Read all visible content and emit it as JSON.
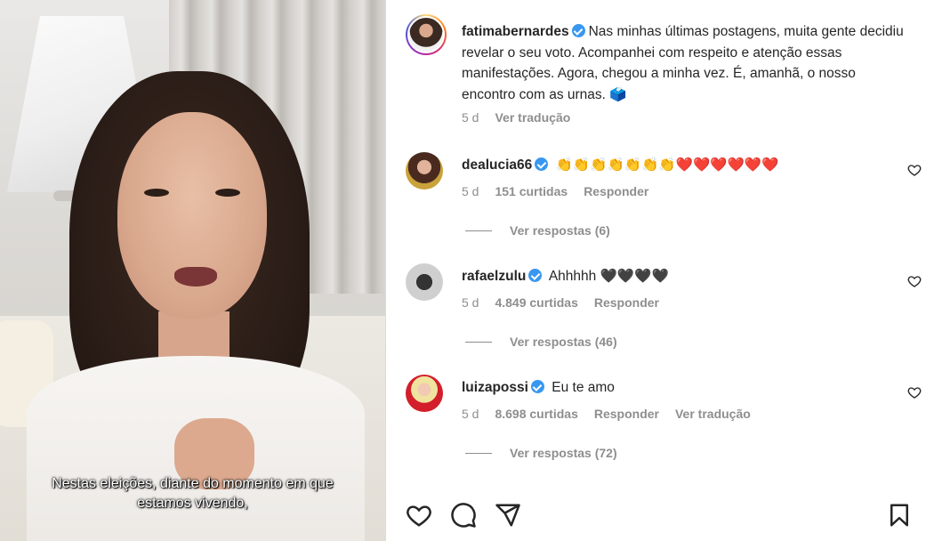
{
  "video": {
    "caption_line1": "Nestas eleições, diante do momento em que",
    "caption_line2": "estamos vivendo,"
  },
  "post": {
    "username": "fatimabernardes",
    "caption": "Nas minhas últimas postagens, muita gente decidiu revelar o seu voto. Acompanhei com respeito e atenção essas manifestações. Agora, chegou a minha vez. É, amanhã, o nosso encontro com as urnas. 🗳️",
    "time": "5 d",
    "translate": "Ver tradução"
  },
  "comments": [
    {
      "username": "dealucia66",
      "text": "👏👏👏👏👏👏👏❤️❤️❤️❤️❤️❤️",
      "time": "5 d",
      "likes": "151 curtidas",
      "reply": "Responder",
      "replies": "Ver respostas (6)"
    },
    {
      "username": "rafaelzulu",
      "text": "Ahhhhh 🖤🖤🖤🖤",
      "time": "5 d",
      "likes": "4.849 curtidas",
      "reply": "Responder",
      "replies": "Ver respostas (46)"
    },
    {
      "username": "luizapossi",
      "text": "Eu te amo",
      "time": "5 d",
      "likes": "8.698 curtidas",
      "reply": "Responder",
      "translate": "Ver tradução",
      "replies": "Ver respostas (72)"
    }
  ],
  "icons": {
    "like": "heart-icon",
    "comment": "comment-icon",
    "share": "share-icon",
    "save": "bookmark-icon",
    "verified": "verified-badge-icon"
  },
  "colors": {
    "verified": "#3897f0",
    "muted": "#8e8e8e",
    "text": "#262626"
  }
}
